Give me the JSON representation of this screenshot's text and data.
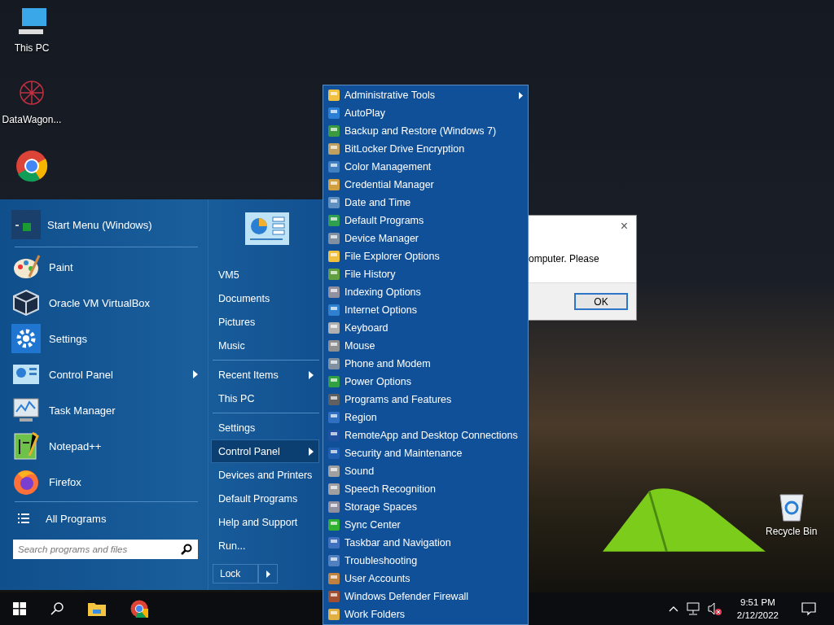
{
  "desktop_icons": [
    {
      "label": "This PC"
    },
    {
      "label": "DataWagon..."
    }
  ],
  "recycle_bin": {
    "label": "Recycle Bin"
  },
  "dialog": {
    "text": "omputer. Please",
    "button": "OK",
    "close": "×"
  },
  "start_menu": {
    "header": "Start Menu (Windows)",
    "pinned": [
      {
        "label": "Paint",
        "has_submenu": false
      },
      {
        "label": "Oracle VM VirtualBox",
        "has_submenu": false
      },
      {
        "label": "Settings",
        "has_submenu": false
      },
      {
        "label": "Control Panel",
        "has_submenu": true
      },
      {
        "label": "Task Manager",
        "has_submenu": false
      },
      {
        "label": "Notepad++",
        "has_submenu": false
      },
      {
        "label": "Firefox",
        "has_submenu": false
      }
    ],
    "all_programs": "All Programs",
    "search": {
      "placeholder": "Search programs and files"
    },
    "right_groups": [
      [
        {
          "label": "VM5",
          "has_submenu": false,
          "selected": false
        },
        {
          "label": "Documents",
          "has_submenu": false,
          "selected": false
        },
        {
          "label": "Pictures",
          "has_submenu": false,
          "selected": false
        },
        {
          "label": "Music",
          "has_submenu": false,
          "selected": false
        }
      ],
      [
        {
          "label": "Recent Items",
          "has_submenu": true,
          "selected": false
        },
        {
          "label": "This PC",
          "has_submenu": false,
          "selected": false
        }
      ],
      [
        {
          "label": "Settings",
          "has_submenu": false,
          "selected": false
        },
        {
          "label": "Control Panel",
          "has_submenu": true,
          "selected": true
        },
        {
          "label": "Devices and Printers",
          "has_submenu": false,
          "selected": false
        },
        {
          "label": "Default Programs",
          "has_submenu": false,
          "selected": false
        },
        {
          "label": "Help and Support",
          "has_submenu": false,
          "selected": false
        },
        {
          "label": "Run...",
          "has_submenu": false,
          "selected": false
        }
      ]
    ],
    "lock": "Lock"
  },
  "control_panel_menu": [
    {
      "label": "Administrative Tools",
      "has_submenu": true
    },
    {
      "label": "AutoPlay",
      "has_submenu": false
    },
    {
      "label": "Backup and Restore (Windows 7)",
      "has_submenu": false
    },
    {
      "label": "BitLocker Drive Encryption",
      "has_submenu": false
    },
    {
      "label": "Color Management",
      "has_submenu": false
    },
    {
      "label": "Credential Manager",
      "has_submenu": false
    },
    {
      "label": "Date and Time",
      "has_submenu": false
    },
    {
      "label": "Default Programs",
      "has_submenu": false
    },
    {
      "label": "Device Manager",
      "has_submenu": false
    },
    {
      "label": "File Explorer Options",
      "has_submenu": false
    },
    {
      "label": "File History",
      "has_submenu": false
    },
    {
      "label": "Indexing Options",
      "has_submenu": false
    },
    {
      "label": "Internet Options",
      "has_submenu": false
    },
    {
      "label": "Keyboard",
      "has_submenu": false
    },
    {
      "label": "Mouse",
      "has_submenu": false
    },
    {
      "label": "Phone and Modem",
      "has_submenu": false
    },
    {
      "label": "Power Options",
      "has_submenu": false
    },
    {
      "label": "Programs and Features",
      "has_submenu": false
    },
    {
      "label": "Region",
      "has_submenu": false
    },
    {
      "label": "RemoteApp and Desktop Connections",
      "has_submenu": false
    },
    {
      "label": "Security and Maintenance",
      "has_submenu": false
    },
    {
      "label": "Sound",
      "has_submenu": false
    },
    {
      "label": "Speech Recognition",
      "has_submenu": false
    },
    {
      "label": "Storage Spaces",
      "has_submenu": false
    },
    {
      "label": "Sync Center",
      "has_submenu": false
    },
    {
      "label": "Taskbar and Navigation",
      "has_submenu": false
    },
    {
      "label": "Troubleshooting",
      "has_submenu": false
    },
    {
      "label": "User Accounts",
      "has_submenu": false
    },
    {
      "label": "Windows Defender Firewall",
      "has_submenu": false
    },
    {
      "label": "Work Folders",
      "has_submenu": false
    }
  ],
  "taskbar": {
    "volume_muted": true,
    "time": "9:51 PM",
    "date": "2/12/2022"
  }
}
